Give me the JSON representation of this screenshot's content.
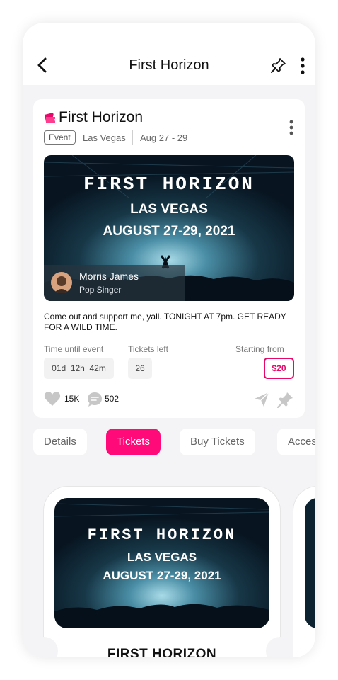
{
  "header": {
    "title": "First Horizon"
  },
  "event": {
    "title": "First Horizon",
    "tag": "Event",
    "location": "Las Vegas",
    "dates": "Aug 27 - 29",
    "poster": {
      "title": "FIRST HORIZON",
      "city": "LAS VEGAS",
      "dates": "AUGUST 27-29, 2021"
    },
    "artist": {
      "name": "Morris James",
      "role": "Pop Singer"
    },
    "description": "Come out and support me, yall. TONIGHT AT 7pm. GET READY FOR A WILD TIME.",
    "stats": {
      "time_label": "Time until event",
      "time_value": "01d  12h  42m",
      "tickets_label": "Tickets left",
      "tickets_value": "26",
      "price_label": "Starting from",
      "price_value": "$20"
    },
    "likes": "15K",
    "comments": "502"
  },
  "tabs": [
    {
      "label": "Details"
    },
    {
      "label": "Tickets"
    },
    {
      "label": "Buy Tickets"
    },
    {
      "label": "Acces"
    }
  ],
  "ticket": {
    "poster": {
      "title": "FIRST HORIZON",
      "city": "LAS VEGAS",
      "dates": "AUGUST 27-29, 2021"
    },
    "title": "FIRST HORIZON"
  },
  "colors": {
    "accent": "#ff0a78",
    "price": "#e8086b",
    "background": "#f4f4f6"
  },
  "icons": [
    "back-arrow-icon",
    "pin-icon",
    "more-vertical-icon",
    "ticket-icon",
    "heart-icon",
    "comment-icon",
    "share-icon"
  ]
}
